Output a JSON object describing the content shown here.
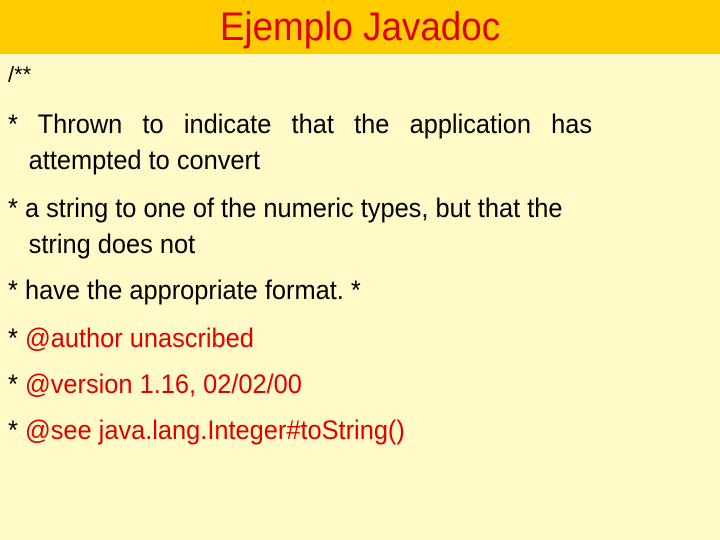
{
  "slide": {
    "title": "Ejemplo Javadoc",
    "colors": {
      "header_bg": "#FFCC00",
      "body_bg": "#FFFAC8",
      "title_color": "#E00000",
      "tag_color": "#E00000",
      "text_color": "#000000"
    },
    "comment_open": "/**",
    "lines": [
      {
        "marker": "*",
        "first": "Thrown to indicate that the application has",
        "cont": "attempted to convert"
      },
      {
        "marker": "*",
        "first": "a string to one of the numeric types, but that the",
        "cont": "string does not"
      },
      {
        "marker": "*",
        "first": "have the appropriate format. *"
      },
      {
        "marker": "*",
        "tag": "@author unascribed"
      },
      {
        "marker": "*",
        "tag": "@version 1.16, 02/02/00"
      },
      {
        "marker": "*",
        "tag": "@see java.lang.Integer#toString()"
      }
    ]
  }
}
